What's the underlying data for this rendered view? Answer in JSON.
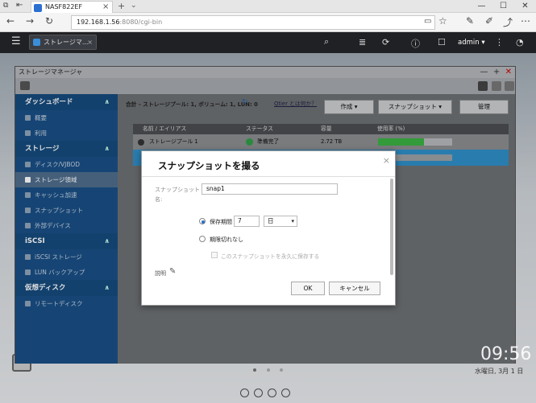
{
  "browser": {
    "tab_title": "NASF822EF",
    "tab_close": "×",
    "url_prefix": "192.168.1.56",
    "url_rest": ":8080/cgi-bin",
    "win_controls": [
      "—",
      "☐",
      "✕"
    ],
    "nav": {
      "back": "←",
      "forward": "→",
      "refresh": "↻"
    },
    "toolbar_icons": [
      "☆",
      "✎",
      "⤴",
      "⋯"
    ]
  },
  "qts": {
    "app_tab_label": "ストレージマ...",
    "app_tab_close": "×",
    "user_label": "admin ▾",
    "menu_icon": "☰",
    "search_icon": "🔍",
    "more_icon": "⋮"
  },
  "window": {
    "title": "ストレージマネージャ",
    "controls": [
      "—",
      "+",
      "✕"
    ],
    "summary": "合計 - ストレージプール: 1, ボリューム: 1, LUN: 0",
    "qtier_link": "Qtier とは何か？",
    "buttons": {
      "create": "作成",
      "snapshot": "スナップショット",
      "manage": "管理"
    },
    "table": {
      "headers": [
        "名前 / エイリアス",
        "ステータス",
        "容量",
        "使用率 (%)"
      ],
      "row": {
        "name": "ストレージプール 1",
        "status": "準備完了",
        "capacity": "2.72 TB",
        "usage_pct": 62
      }
    }
  },
  "sidebar": {
    "sections": [
      {
        "title": "ダッシュボード",
        "items": [
          "概要",
          "利用"
        ]
      },
      {
        "title": "ストレージ",
        "items": [
          "ディスク/VJBOD",
          "ストレージ領域",
          "キャッシュ加速",
          "スナップショット",
          "外部デバイス"
        ]
      },
      {
        "title": "iSCSI",
        "items": [
          "iSCSI ストレージ",
          "LUN バックアップ"
        ]
      },
      {
        "title": "仮想ディスク",
        "items": [
          "リモートディスク"
        ]
      }
    ],
    "selected": "ストレージ領域"
  },
  "dialog": {
    "title": "スナップショットを撮る",
    "name_label": "スナップショット名:",
    "name_value": "snap1",
    "retention_label": "保存期間",
    "retention_value": "7",
    "retention_unit": "日",
    "no_expiry_label": "期限切れなし",
    "keep_forever_label": "このスナップショットを永久に保存する",
    "description_label": "説明",
    "ok": "OK",
    "cancel": "キャンセル",
    "close": "×"
  },
  "desktop": {
    "clock": "09:56",
    "date": "水曜日, 3月 1 日"
  },
  "colors": {
    "accent": "#2a6fc9",
    "sidebar": "#1a4f86",
    "selected_row": "#2f8ec6",
    "usage_bar": "#3bb143"
  }
}
